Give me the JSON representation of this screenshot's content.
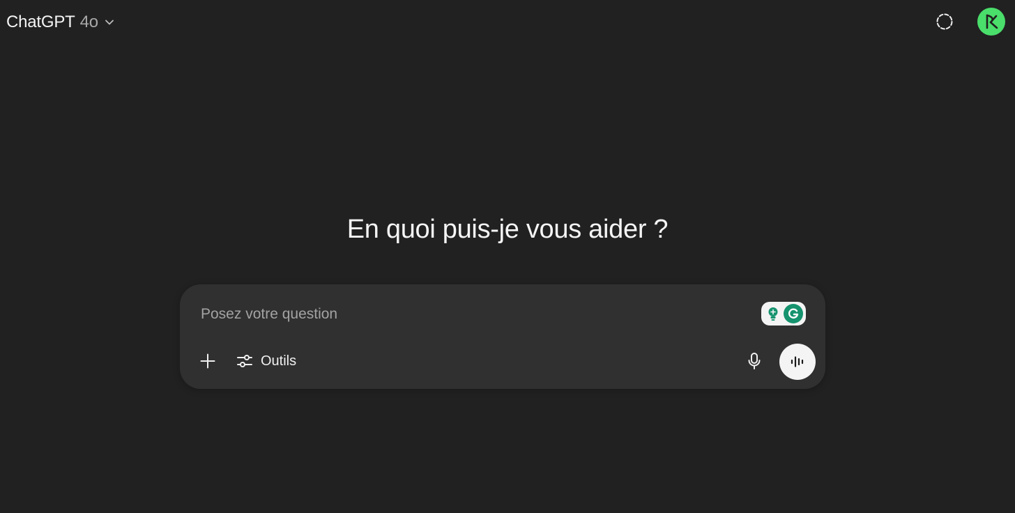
{
  "header": {
    "model_name": "ChatGPT",
    "model_version": "4o",
    "icons": {
      "model_dropdown": "chevron-down-icon",
      "temporary_chat": "dashed-circle-icon",
      "avatar": "user-avatar-icon"
    }
  },
  "main": {
    "greeting": "En quoi puis-je vous aider ?"
  },
  "composer": {
    "placeholder": "Posez votre question",
    "tools_label": "Outils",
    "icons": {
      "add": "plus-icon",
      "tools": "sliders-icon",
      "microphone": "microphone-icon",
      "voice_mode": "voice-waveform-icon",
      "grammarly": "grammarly-icon"
    }
  },
  "colors": {
    "background": "#212121",
    "composer_background": "#303030",
    "avatar_green": "#4ade6b",
    "grammarly_green": "#15936e",
    "voice_button": "#f4f4f4"
  }
}
